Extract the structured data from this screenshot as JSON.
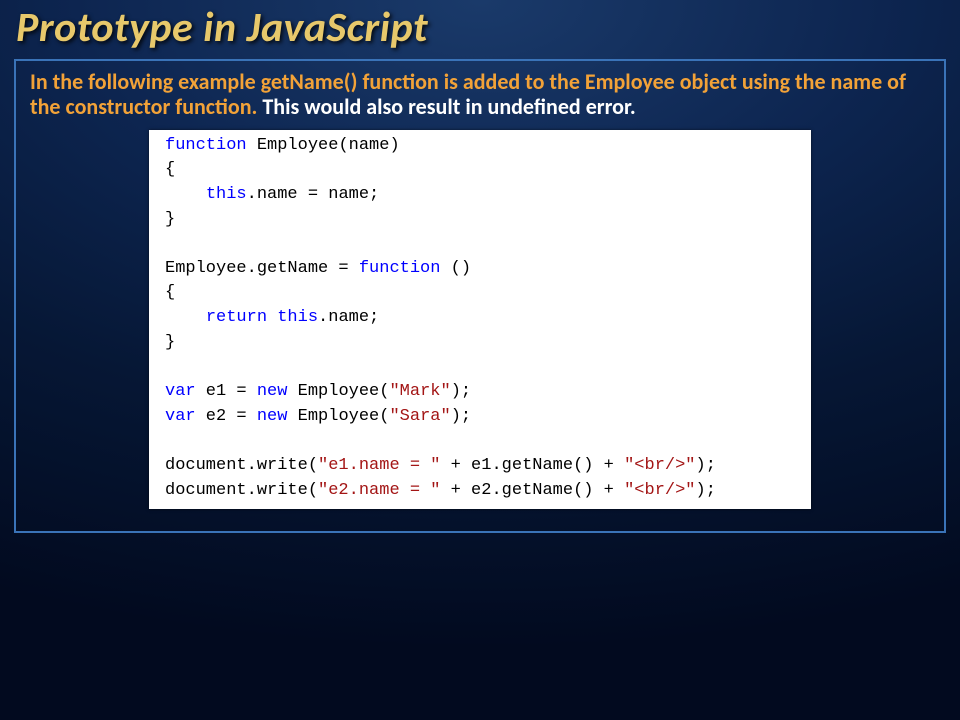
{
  "title": "Prototype in JavaScript",
  "desc_orange": "In the following example getName() function is added to the Employee object using the name of the constructor function.",
  "desc_white": " This would also result in undefined error.",
  "code": {
    "l1_kw": "function",
    "l1_txt": " Employee(name)",
    "l2": "{",
    "l3a": "    ",
    "l3_kw": "this",
    "l3b": ".name = name;",
    "l4": "}",
    "l5": "",
    "l6a": "Employee.getName = ",
    "l6_kw": "function",
    "l6b": " ()",
    "l7": "{",
    "l8a": "    ",
    "l8_kw1": "return",
    "l8b": " ",
    "l8_kw2": "this",
    "l8c": ".name;",
    "l9": "}",
    "l10": "",
    "l11_kw1": "var",
    "l11a": " e1 = ",
    "l11_kw2": "new",
    "l11b": " Employee(",
    "l11_str": "\"Mark\"",
    "l11c": ");",
    "l12_kw1": "var",
    "l12a": " e2 = ",
    "l12_kw2": "new",
    "l12b": " Employee(",
    "l12_str": "\"Sara\"",
    "l12c": ");",
    "l13": "",
    "l14a": "document.write(",
    "l14_str1": "\"e1.name = \"",
    "l14b": " + e1.getName() + ",
    "l14_str2": "\"<br/>\"",
    "l14c": ");",
    "l15a": "document.write(",
    "l15_str1": "\"e2.name = \"",
    "l15b": " + e2.getName() + ",
    "l15_str2": "\"<br/>\"",
    "l15c": ");"
  }
}
